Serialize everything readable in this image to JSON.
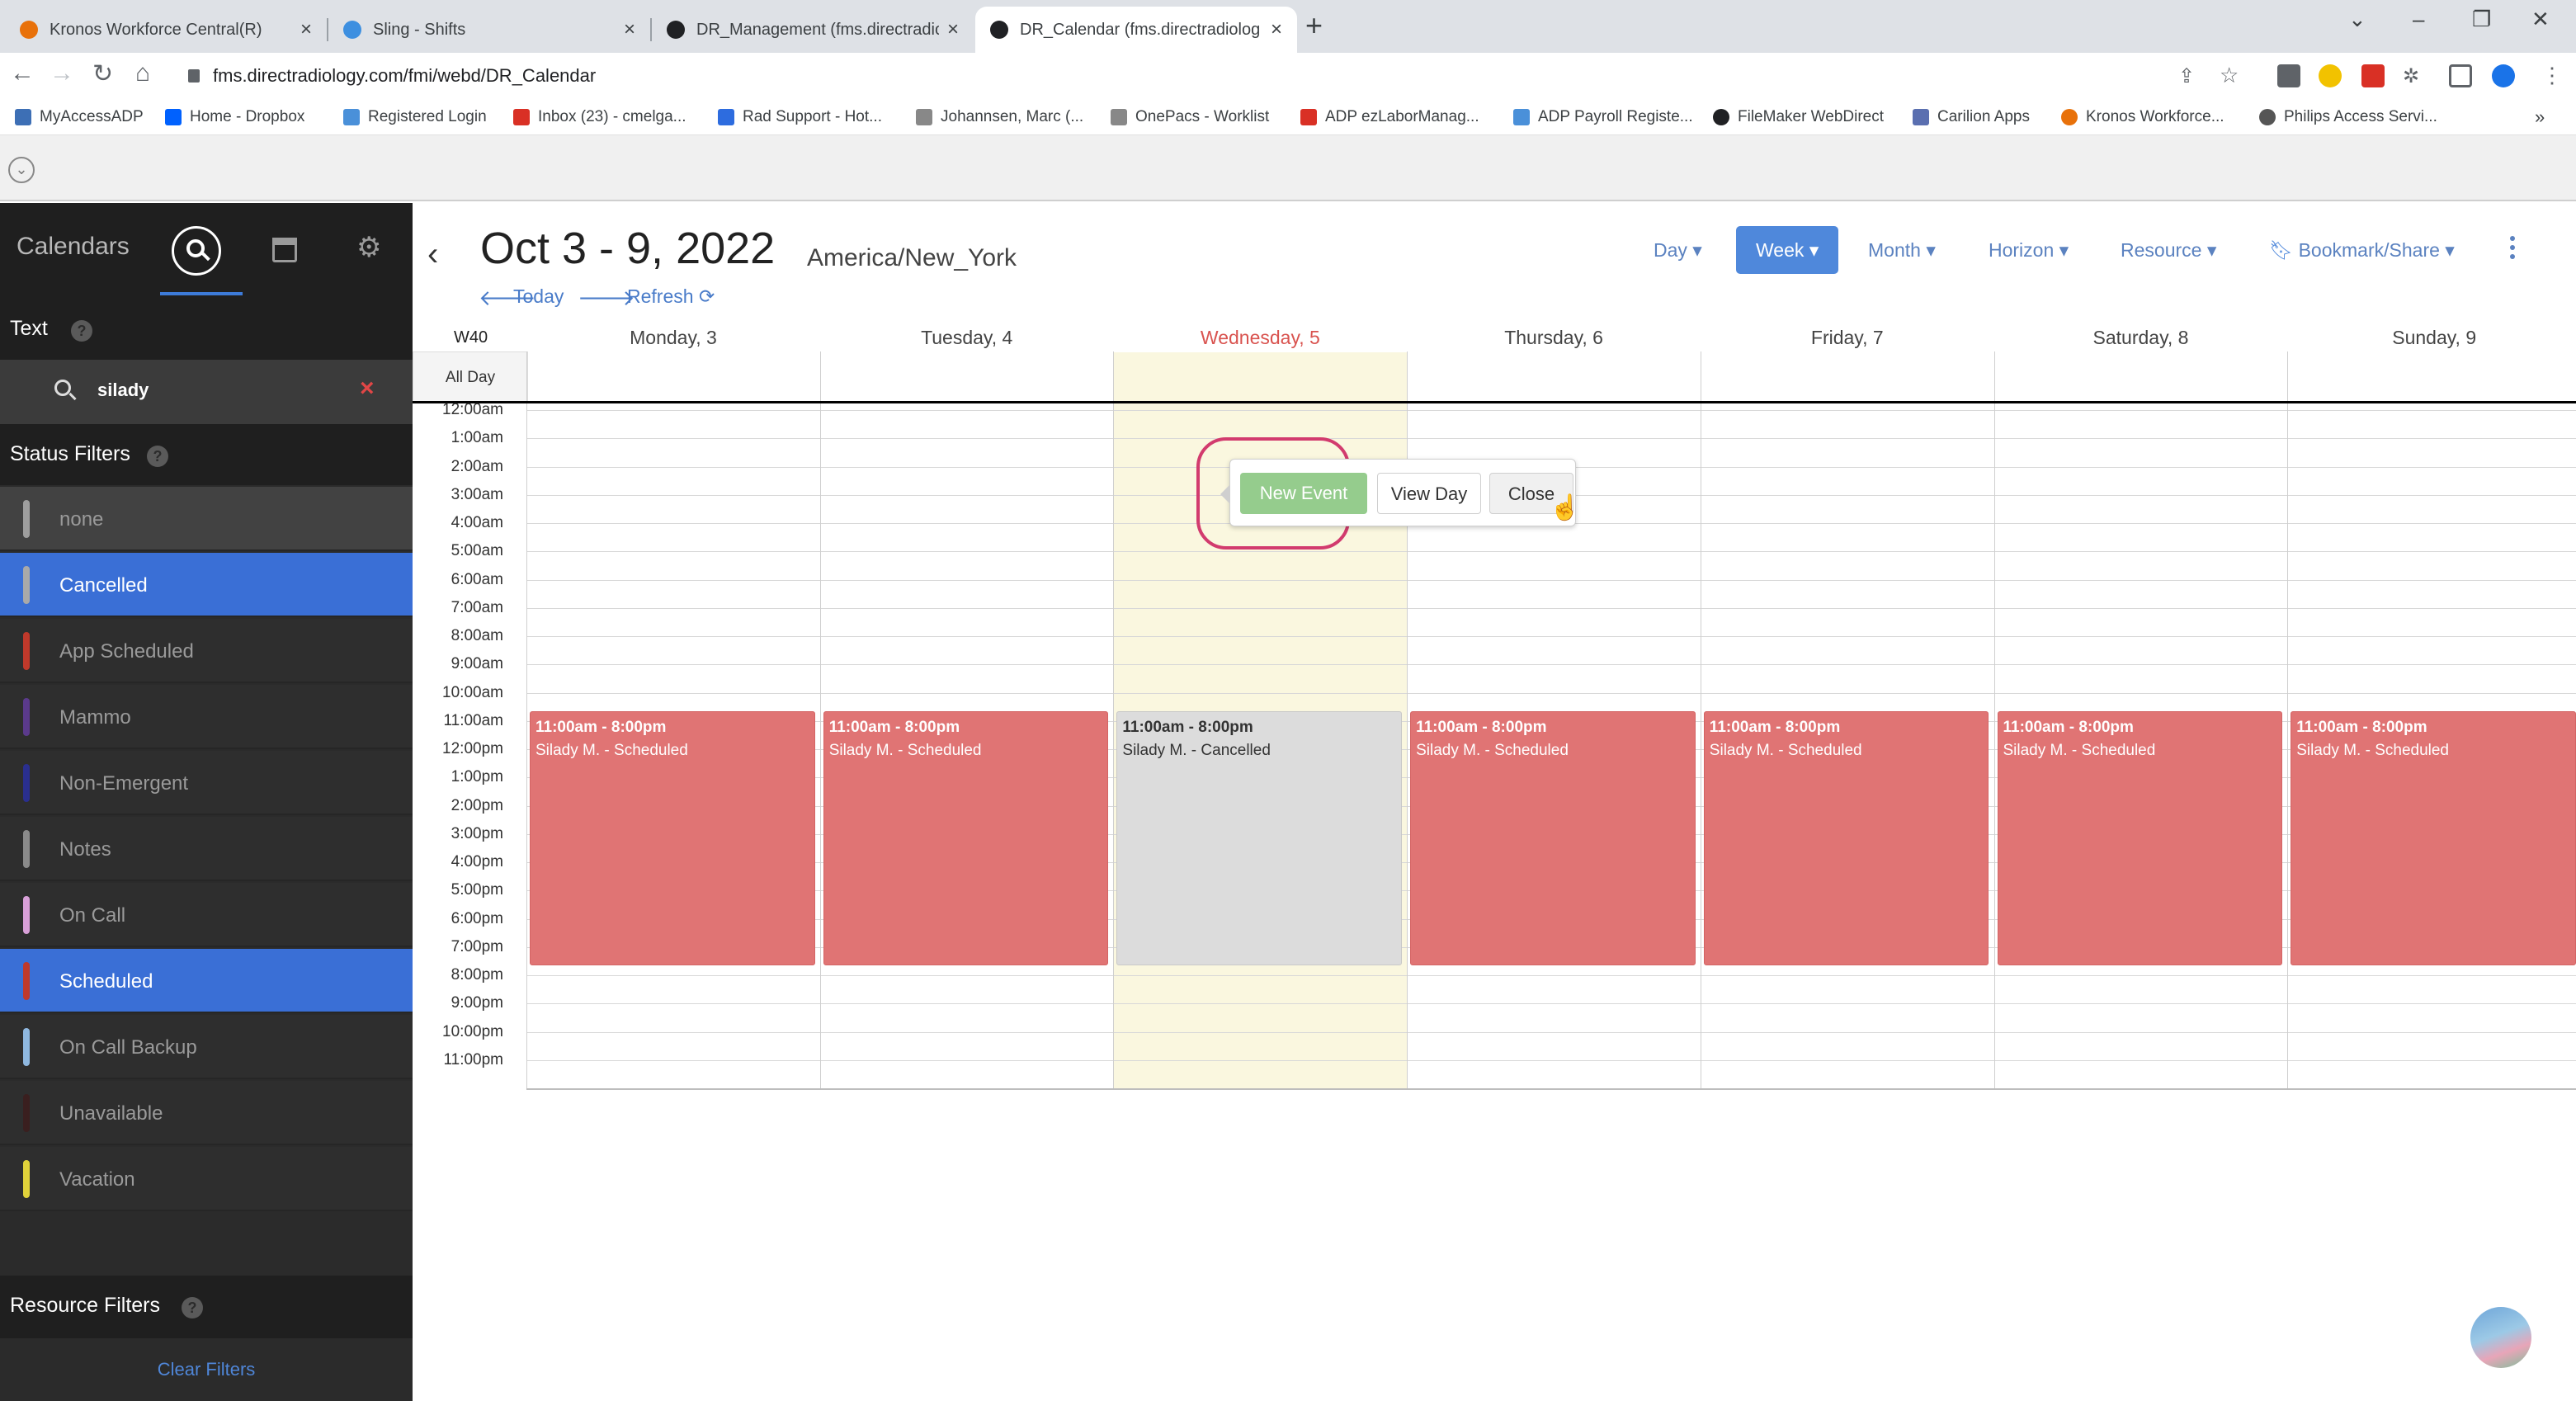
{
  "browser": {
    "tabs": [
      {
        "title": "Kronos Workforce Central(R)",
        "active": false,
        "color": "#e8710a"
      },
      {
        "title": "Sling - Shifts",
        "active": false,
        "color": "#3d8fe0"
      },
      {
        "title": "DR_Management (fms.directradio",
        "active": false,
        "color": "#202124"
      },
      {
        "title": "DR_Calendar (fms.directradiolog",
        "active": true,
        "color": "#202124"
      }
    ],
    "url": "fms.directradiology.com/fmi/webd/DR_Calendar",
    "bookmarks": [
      {
        "label": "MyAccessADP",
        "color": "#3d6fb5"
      },
      {
        "label": "Home - Dropbox",
        "color": "#0061fe"
      },
      {
        "label": "Registered Login",
        "color": "#4a90d9"
      },
      {
        "label": "Inbox (23) - cmelga...",
        "color": "#d93025"
      },
      {
        "label": "Rad Support - Hot...",
        "color": "#2d6cdf"
      },
      {
        "label": "Johannsen, Marc (...",
        "color": "#888888"
      },
      {
        "label": "OnePacs - Worklist",
        "color": "#888888"
      },
      {
        "label": "ADP ezLaborManag...",
        "color": "#d93025"
      },
      {
        "label": "ADP Payroll Registe...",
        "color": "#4a90d9"
      },
      {
        "label": "FileMaker WebDirect",
        "color": "#202124"
      },
      {
        "label": "Carilion Apps",
        "color": "#5a6fb0"
      },
      {
        "label": "Kronos Workforce...",
        "color": "#e8710a"
      },
      {
        "label": "Philips Access Servi...",
        "color": "#555555"
      }
    ]
  },
  "sidebar": {
    "title": "Calendars",
    "text_section": "Text",
    "search_value": "silady",
    "status_section": "Status Filters",
    "statuses": [
      {
        "label": "none",
        "color": "#9e9e9e",
        "selected": false
      },
      {
        "label": "Cancelled",
        "color": "#a9a9a9",
        "selected": true
      },
      {
        "label": "App Scheduled",
        "color": "#c0392b",
        "selected": false
      },
      {
        "label": "Mammo",
        "color": "#5b3a8c",
        "selected": false
      },
      {
        "label": "Non-Emergent",
        "color": "#2a2f8f",
        "selected": false
      },
      {
        "label": "Notes",
        "color": "#8a8a8a",
        "selected": false
      },
      {
        "label": "On Call",
        "color": "#d8a0d8",
        "selected": false
      },
      {
        "label": "Scheduled",
        "color": "#c0392b",
        "selected": true
      },
      {
        "label": "On Call Backup",
        "color": "#8fb8e0",
        "selected": false
      },
      {
        "label": "Unavailable",
        "color": "#3a1f1f",
        "selected": false
      },
      {
        "label": "Vacation",
        "color": "#e0d23a",
        "selected": false
      }
    ],
    "resource_section": "Resource Filters",
    "clear_filters": "Clear Filters"
  },
  "calendar": {
    "range_title": "Oct 3 - 9, 2022",
    "timezone": "America/New_York",
    "today_label": "Today",
    "refresh_label": "Refresh",
    "views": {
      "day": "Day ▾",
      "week": "Week ▾",
      "month": "Month ▾",
      "horizon": "Horizon ▾",
      "resource": "Resource ▾",
      "bookmark": "Bookmark/Share ▾"
    },
    "week_number": "W40",
    "all_day_label": "All Day",
    "days": [
      "Monday, 3",
      "Tuesday, 4",
      "Wednesday, 5",
      "Thursday, 6",
      "Friday, 7",
      "Saturday, 8",
      "Sunday, 9"
    ],
    "today_index": 2,
    "hours": [
      "12:00am",
      "1:00am",
      "2:00am",
      "3:00am",
      "4:00am",
      "5:00am",
      "6:00am",
      "7:00am",
      "8:00am",
      "9:00am",
      "10:00am",
      "11:00am",
      "12:00pm",
      "1:00pm",
      "2:00pm",
      "3:00pm",
      "4:00pm",
      "5:00pm",
      "6:00pm",
      "7:00pm",
      "8:00pm",
      "9:00pm",
      "10:00pm",
      "11:00pm"
    ],
    "events": [
      {
        "day": 0,
        "time": "11:00am - 8:00pm",
        "title": "Silady M. - Scheduled",
        "status": "scheduled"
      },
      {
        "day": 1,
        "time": "11:00am - 8:00pm",
        "title": "Silady M. - Scheduled",
        "status": "scheduled"
      },
      {
        "day": 2,
        "time": "11:00am - 8:00pm",
        "title": "Silady M. - Cancelled",
        "status": "cancelled"
      },
      {
        "day": 3,
        "time": "11:00am - 8:00pm",
        "title": "Silady M. - Scheduled",
        "status": "scheduled"
      },
      {
        "day": 4,
        "time": "11:00am - 8:00pm",
        "title": "Silady M. - Scheduled",
        "status": "scheduled"
      },
      {
        "day": 5,
        "time": "11:00am - 8:00pm",
        "title": "Silady M. - Scheduled",
        "status": "scheduled"
      },
      {
        "day": 6,
        "time": "11:00am - 8:00pm",
        "title": "Silady M. - Scheduled",
        "status": "scheduled"
      }
    ],
    "popup": {
      "new_event": "New Event",
      "view_day": "View Day",
      "close": "Close"
    }
  }
}
